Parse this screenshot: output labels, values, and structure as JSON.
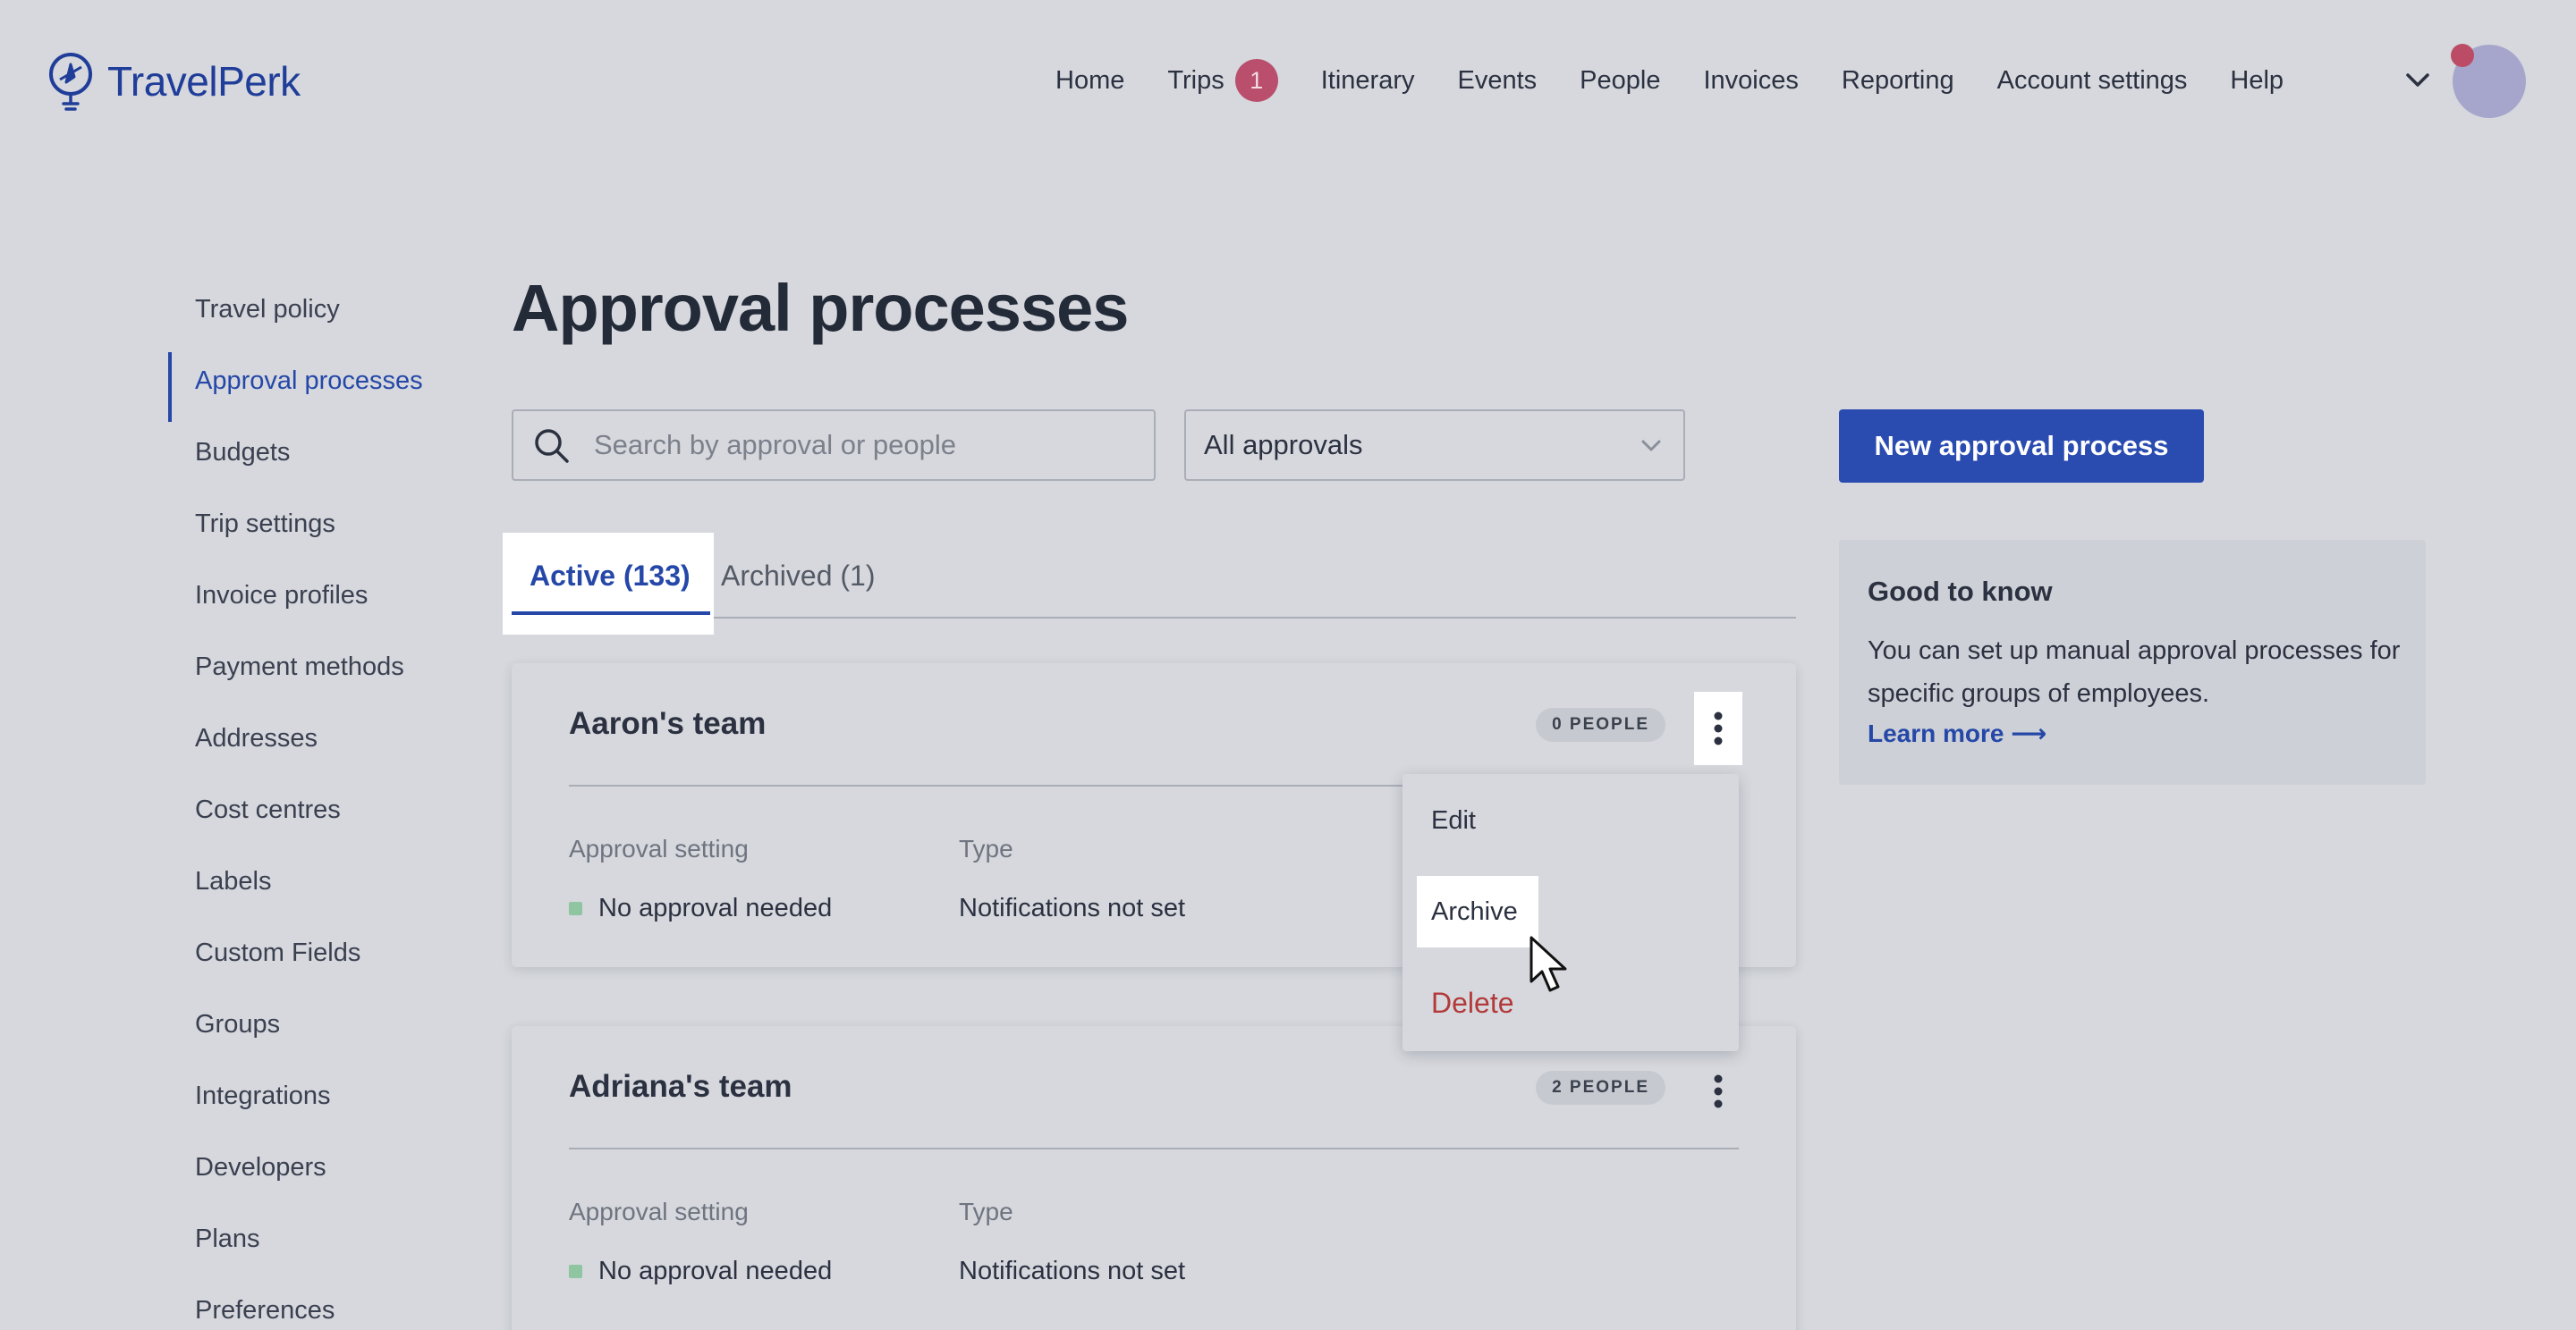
{
  "header": {
    "logo_text": "TravelPerk",
    "nav": [
      {
        "label": "Home"
      },
      {
        "label": "Trips",
        "badge": "1"
      },
      {
        "label": "Itinerary"
      },
      {
        "label": "Events"
      },
      {
        "label": "People"
      },
      {
        "label": "Invoices"
      },
      {
        "label": "Reporting"
      },
      {
        "label": "Account settings"
      },
      {
        "label": "Help"
      }
    ]
  },
  "sidebar": {
    "items": [
      {
        "label": "Travel policy"
      },
      {
        "label": "Approval processes",
        "active": true
      },
      {
        "label": "Budgets"
      },
      {
        "label": "Trip settings"
      },
      {
        "label": "Invoice profiles"
      },
      {
        "label": "Payment methods"
      },
      {
        "label": "Addresses"
      },
      {
        "label": "Cost centres"
      },
      {
        "label": "Labels"
      },
      {
        "label": "Custom Fields"
      },
      {
        "label": "Groups"
      },
      {
        "label": "Integrations"
      },
      {
        "label": "Developers"
      },
      {
        "label": "Plans"
      },
      {
        "label": "Preferences"
      }
    ]
  },
  "main": {
    "title": "Approval processes",
    "search": {
      "placeholder": "Search by approval or people",
      "value": ""
    },
    "filter": {
      "selected": "All approvals"
    },
    "new_button": "New approval process",
    "tabs": [
      {
        "label": "Active (133)",
        "active": true
      },
      {
        "label": "Archived (1)",
        "active": false
      }
    ],
    "cards": [
      {
        "name": "Aaron's team",
        "people": "0 PEOPLE",
        "approval_label": "Approval setting",
        "approval_value": "No approval needed",
        "type_label": "Type",
        "type_value": "Notifications not set"
      },
      {
        "name": "Adriana's team",
        "people": "2 PEOPLE",
        "approval_label": "Approval setting",
        "approval_value": "No approval needed",
        "type_label": "Type",
        "type_value": "Notifications not set"
      }
    ],
    "menu": {
      "edit": "Edit",
      "archive": "Archive",
      "delete": "Delete"
    }
  },
  "info": {
    "title": "Good to know",
    "text": "You can set up manual approval processes for specific groups of employees.",
    "link": "Learn more ⟶"
  },
  "colors": {
    "background": "#d6d8dd",
    "accent": "#2a4bb0",
    "badge": "#b94f6c",
    "danger": "#b33a3a",
    "status_green": "#8fc5a0"
  },
  "icons": {
    "logo": "plane-pin-icon",
    "search": "search-icon",
    "select": "chevron-down-icon",
    "kebab": "kebab-menu-icon",
    "cursor": "mouse-pointer-icon"
  }
}
